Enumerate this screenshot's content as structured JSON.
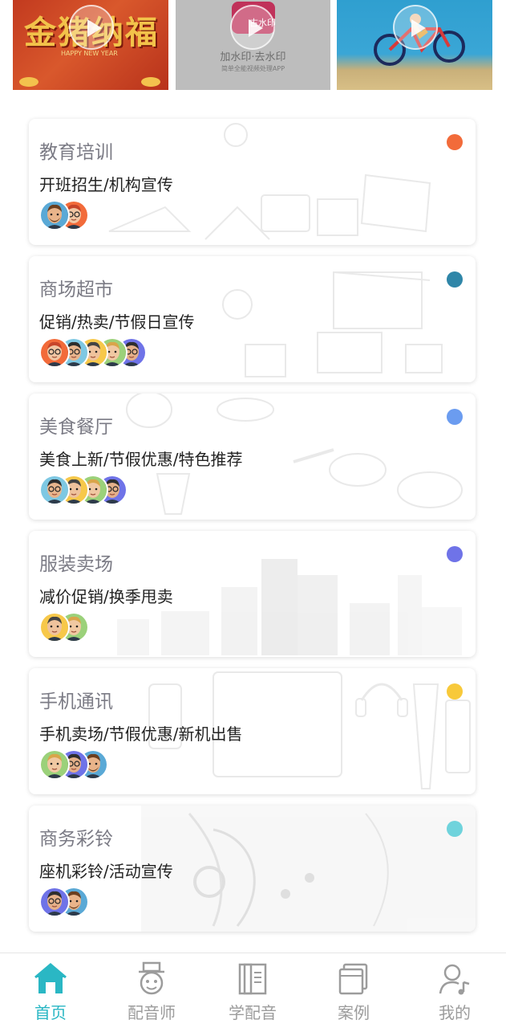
{
  "videos": [
    {
      "festive_text": "金猪纳福",
      "festive_sub": "HAPPY NEW YEAR"
    },
    {
      "logo_text": "古水印",
      "app_name": "加水印·去水印",
      "app_slogan": "简单全能视频处理APP"
    },
    {}
  ],
  "categories": [
    {
      "title": "教育培训",
      "subtitle": "开班招生/机构宣传",
      "dot_color": "#f26b3a",
      "avatar_count": 2
    },
    {
      "title": "商场超市",
      "subtitle": "促销/热卖/节假日宣传",
      "dot_color": "#2f86a8",
      "avatar_count": 5
    },
    {
      "title": "美食餐厅",
      "subtitle": "美食上新/节假优惠/特色推荐",
      "dot_color": "#6b9cf0",
      "avatar_count": 4
    },
    {
      "title": "服装卖场",
      "subtitle": "减价促销/换季甩卖",
      "dot_color": "#6f73e8",
      "avatar_count": 2
    },
    {
      "title": "手机通讯",
      "subtitle": "手机卖场/节假优惠/新机出售",
      "dot_color": "#f8c93a",
      "avatar_count": 3
    },
    {
      "title": "商务彩铃",
      "subtitle": "座机彩铃/活动宣传",
      "dot_color": "#6fd3dc",
      "avatar_count": 2
    }
  ],
  "tabs": [
    {
      "label": "首页",
      "icon": "home-icon",
      "active": true
    },
    {
      "label": "配音师",
      "icon": "voice-actor-icon",
      "active": false
    },
    {
      "label": "学配音",
      "icon": "learn-book-icon",
      "active": false
    },
    {
      "label": "案例",
      "icon": "cases-icon",
      "active": false
    },
    {
      "label": "我的",
      "icon": "profile-music-icon",
      "active": false
    }
  ],
  "colors": {
    "accent": "#2ab7c4",
    "inactive": "#9c9c9c"
  }
}
